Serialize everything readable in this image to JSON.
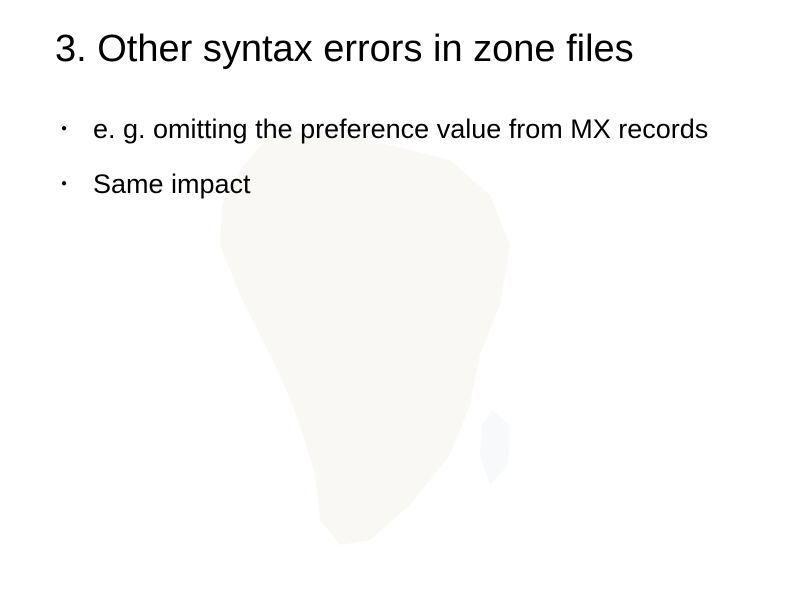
{
  "title": "3. Other syntax errors in zone files",
  "bullets": [
    "e. g. omitting the preference value from MX records",
    "Same impact"
  ]
}
